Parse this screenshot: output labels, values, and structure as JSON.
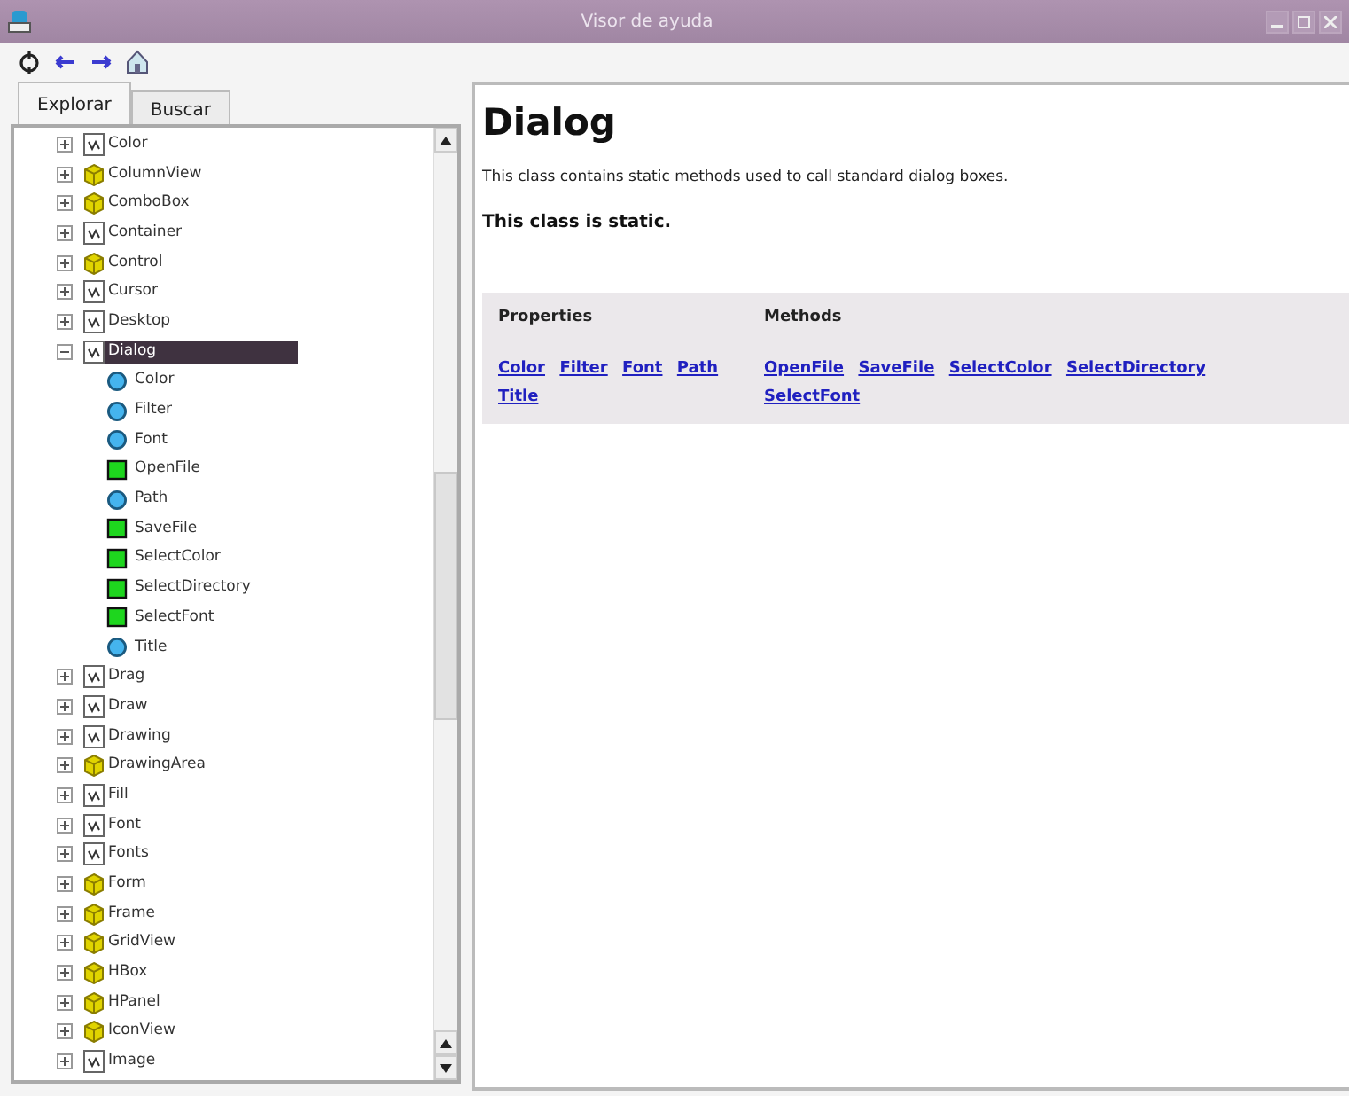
{
  "window": {
    "title": "Visor de ayuda"
  },
  "tabs": [
    {
      "label": "Explorar",
      "selected": true
    },
    {
      "label": "Buscar",
      "selected": false
    }
  ],
  "tree": [
    {
      "label": "Color",
      "kind": "module",
      "expanded": false
    },
    {
      "label": "ColumnView",
      "kind": "class",
      "expanded": false
    },
    {
      "label": "ComboBox",
      "kind": "class",
      "expanded": false
    },
    {
      "label": "Container",
      "kind": "module",
      "expanded": false
    },
    {
      "label": "Control",
      "kind": "class",
      "expanded": false
    },
    {
      "label": "Cursor",
      "kind": "module",
      "expanded": false
    },
    {
      "label": "Desktop",
      "kind": "module",
      "expanded": false
    },
    {
      "label": "Dialog",
      "kind": "module",
      "expanded": true,
      "selected": true,
      "children": [
        {
          "label": "Color",
          "kind": "property"
        },
        {
          "label": "Filter",
          "kind": "property"
        },
        {
          "label": "Font",
          "kind": "property"
        },
        {
          "label": "OpenFile",
          "kind": "method"
        },
        {
          "label": "Path",
          "kind": "property"
        },
        {
          "label": "SaveFile",
          "kind": "method"
        },
        {
          "label": "SelectColor",
          "kind": "method"
        },
        {
          "label": "SelectDirectory",
          "kind": "method"
        },
        {
          "label": "SelectFont",
          "kind": "method"
        },
        {
          "label": "Title",
          "kind": "property"
        }
      ]
    },
    {
      "label": "Drag",
      "kind": "module",
      "expanded": false
    },
    {
      "label": "Draw",
      "kind": "module",
      "expanded": false
    },
    {
      "label": "Drawing",
      "kind": "module",
      "expanded": false
    },
    {
      "label": "DrawingArea",
      "kind": "class",
      "expanded": false
    },
    {
      "label": "Fill",
      "kind": "module",
      "expanded": false
    },
    {
      "label": "Font",
      "kind": "module",
      "expanded": false
    },
    {
      "label": "Fonts",
      "kind": "module",
      "expanded": false
    },
    {
      "label": "Form",
      "kind": "class",
      "expanded": false
    },
    {
      "label": "Frame",
      "kind": "class",
      "expanded": false
    },
    {
      "label": "GridView",
      "kind": "class",
      "expanded": false
    },
    {
      "label": "HBox",
      "kind": "class",
      "expanded": false
    },
    {
      "label": "HPanel",
      "kind": "class",
      "expanded": false
    },
    {
      "label": "IconView",
      "kind": "class",
      "expanded": false
    },
    {
      "label": "Image",
      "kind": "module",
      "expanded": false
    }
  ],
  "page": {
    "title": "Dialog",
    "description": "This class contains static methods used to call standard dialog boxes.",
    "note": "This class is static.",
    "properties": {
      "heading": "Properties",
      "links": [
        "Color",
        "Filter",
        "Font",
        "Path",
        "Title"
      ]
    },
    "methods": {
      "heading": "Methods",
      "links": [
        "OpenFile",
        "SaveFile",
        "SelectColor",
        "SelectDirectory",
        "SelectFont"
      ]
    }
  }
}
